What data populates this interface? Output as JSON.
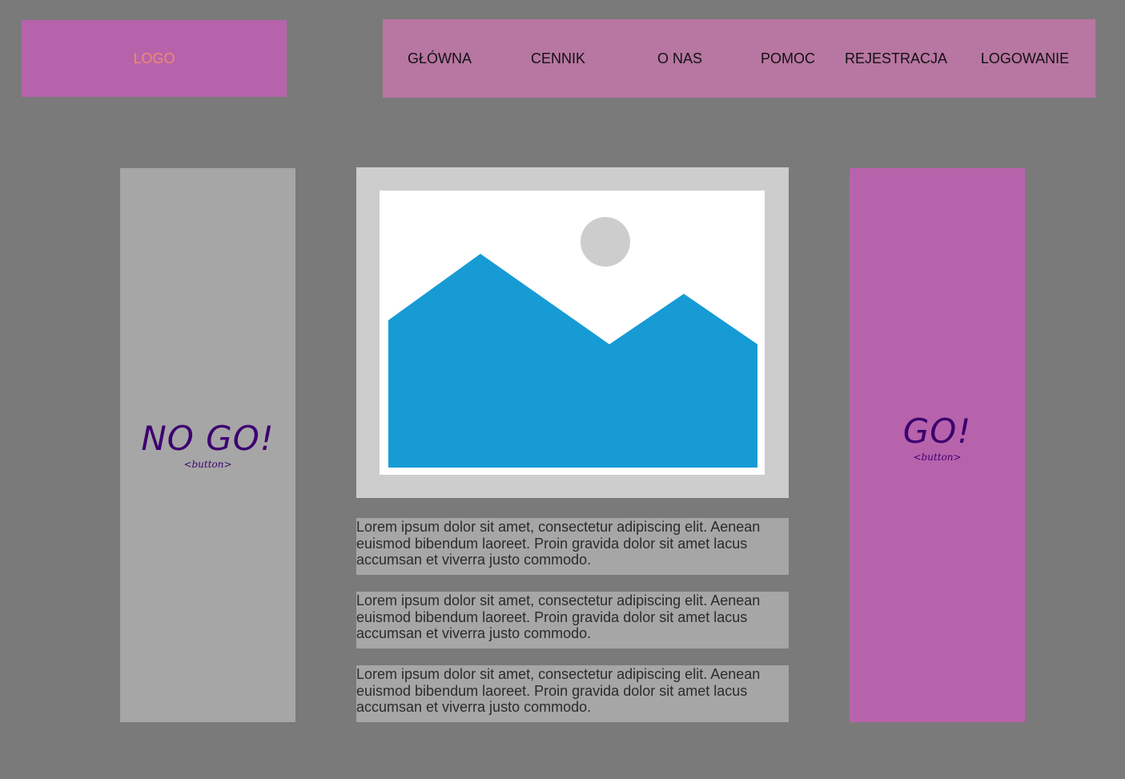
{
  "header": {
    "logo_text": "LOGO",
    "nav_items": [
      {
        "label": "GŁÓWNA"
      },
      {
        "label": "CENNIK"
      },
      {
        "label": "O NAS"
      },
      {
        "label": "POMOC"
      },
      {
        "label": "REJESTRACJA"
      },
      {
        "label": "LOGOWANIE"
      }
    ]
  },
  "left_panel": {
    "title": "NO GO!",
    "subtitle": "<button>"
  },
  "right_panel": {
    "title": "GO!",
    "subtitle": "<button>"
  },
  "main": {
    "image_placeholder_icon": "image-placeholder-icon",
    "paragraphs": [
      "Lorem ipsum dolor sit amet, consectetur adipiscing elit. Aenean euismod bibendum laoreet. Proin gravida dolor sit amet lacus accumsan et viverra justo commodo.",
      "Lorem ipsum dolor sit amet, consectetur adipiscing elit. Aenean euismod bibendum laoreet. Proin gravida dolor sit amet lacus accumsan et viverra justo commodo.",
      "Lorem ipsum dolor sit amet, consectetur adipiscing elit. Aenean euismod bibendum laoreet. Proin gravida dolor sit amet lacus accumsan et viverra justo commodo."
    ]
  },
  "colors": {
    "background": "#7a7a7a",
    "logo_bg": "#b763ab",
    "logo_text": "#f08a72",
    "nav_bg": "#b876a2",
    "panel_gray": "#a6a6a6",
    "panel_pink": "#b763ab",
    "button_text": "#3d0070",
    "mountain": "#179bd5",
    "sun": "#cdcdcd"
  }
}
